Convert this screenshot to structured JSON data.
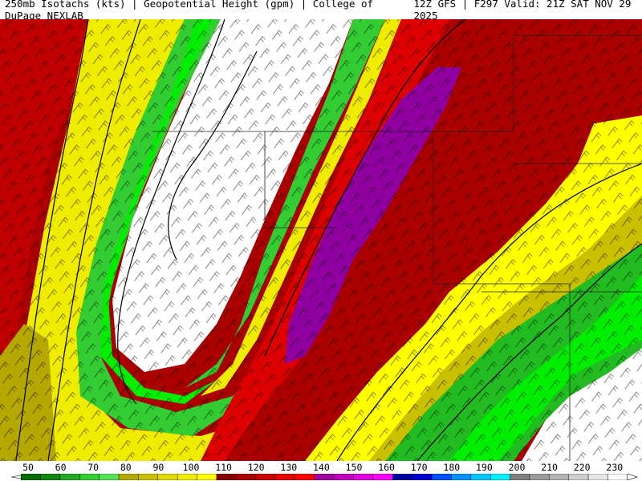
{
  "header": {
    "left": "250mb Isotachs (kts) | Geopotential Height (gpm) | College of DuPage NEXLAB",
    "right": "12Z GFS | F297 Valid: 21Z SAT NOV 29 2025"
  },
  "legend": {
    "ticks": [
      "50",
      "60",
      "70",
      "80",
      "90",
      "100",
      "110",
      "120",
      "130",
      "140",
      "150",
      "160",
      "170",
      "180",
      "190",
      "200",
      "210",
      "220",
      "230"
    ],
    "colors": [
      "#0a6b0a",
      "#118811",
      "#22aa22",
      "#33cc33",
      "#55e055",
      "#b5a800",
      "#c9c000",
      "#e0d800",
      "#f0ec00",
      "#ffff00",
      "#8a0000",
      "#aa0000",
      "#cc0000",
      "#e60000",
      "#ff0000",
      "#a000a0",
      "#c000c0",
      "#e000e0",
      "#ff00ff",
      "#0000a0",
      "#0000d0",
      "#0050ff",
      "#0090ff",
      "#00c8ff",
      "#00f0ff",
      "#808080",
      "#9a9a9a",
      "#b4b4b4",
      "#cecece",
      "#e6e6e6",
      "#ffffff"
    ]
  },
  "map_colors": {
    "bg_red": "#8b0000",
    "red": "#cc0000",
    "dark_red": "#aa0000",
    "purple": "#9000a0",
    "yellow": "#ffff00",
    "olive": "#c9c000",
    "green": "#33cc33",
    "bright_green": "#00ff00",
    "white": "#ffffff"
  }
}
